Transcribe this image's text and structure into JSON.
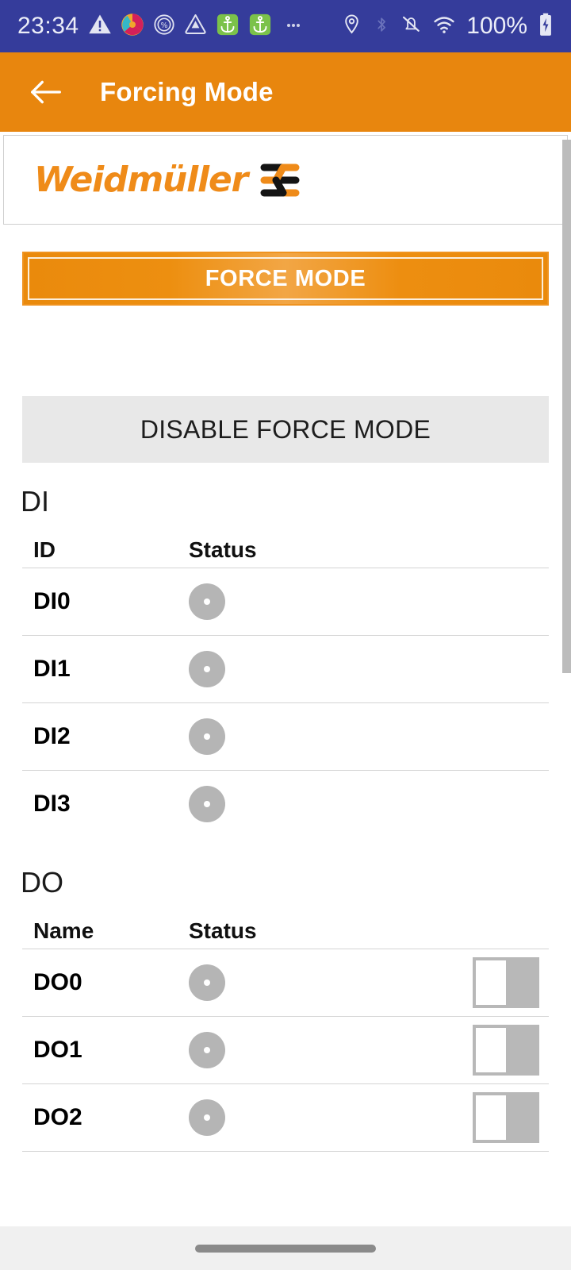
{
  "status_bar": {
    "time": "23:34",
    "battery_percent": "100%",
    "left_icons": [
      {
        "name": "warning-triangle-icon"
      },
      {
        "name": "colorful-app-icon"
      },
      {
        "name": "percent-circle-icon"
      },
      {
        "name": "triangle-drop-icon"
      },
      {
        "name": "anchor-app-icon-1"
      },
      {
        "name": "anchor-app-icon-2"
      },
      {
        "name": "more-notifications-icon"
      }
    ],
    "right_icons": [
      {
        "name": "location-pin-icon"
      },
      {
        "name": "bluetooth-icon"
      },
      {
        "name": "ringer-muted-icon"
      },
      {
        "name": "wifi-icon"
      },
      {
        "name": "battery-charging-icon"
      }
    ]
  },
  "app_bar": {
    "back_label": "back",
    "title": "Forcing Mode"
  },
  "brand": {
    "name": "Weidmüller",
    "mark": "weidmuller-logo-mark"
  },
  "actions": {
    "force_mode": "FORCE MODE",
    "disable_force_mode": "DISABLE FORCE MODE"
  },
  "di_section": {
    "title": "DI",
    "columns": {
      "name": "ID",
      "status": "Status"
    },
    "rows": [
      {
        "name": "DI0",
        "status": "off"
      },
      {
        "name": "DI1",
        "status": "off"
      },
      {
        "name": "DI2",
        "status": "off"
      },
      {
        "name": "DI3",
        "status": "off"
      }
    ]
  },
  "do_section": {
    "title": "DO",
    "columns": {
      "name": "Name",
      "status": "Status"
    },
    "rows": [
      {
        "name": "DO0",
        "status": "off",
        "toggle": "off"
      },
      {
        "name": "DO1",
        "status": "off",
        "toggle": "off"
      },
      {
        "name": "DO2",
        "status": "off",
        "toggle": "off"
      }
    ]
  },
  "colors": {
    "status_bar_bg": "#353c9b",
    "app_bar_bg": "#e8860e",
    "brand_orange": "#ef8b19",
    "disabled_gray": "#e8e8e8",
    "led_gray": "#b5b5b5",
    "switch_gray": "#b8b8b8"
  },
  "nav_bar": {
    "handle": "gesture-handle"
  }
}
